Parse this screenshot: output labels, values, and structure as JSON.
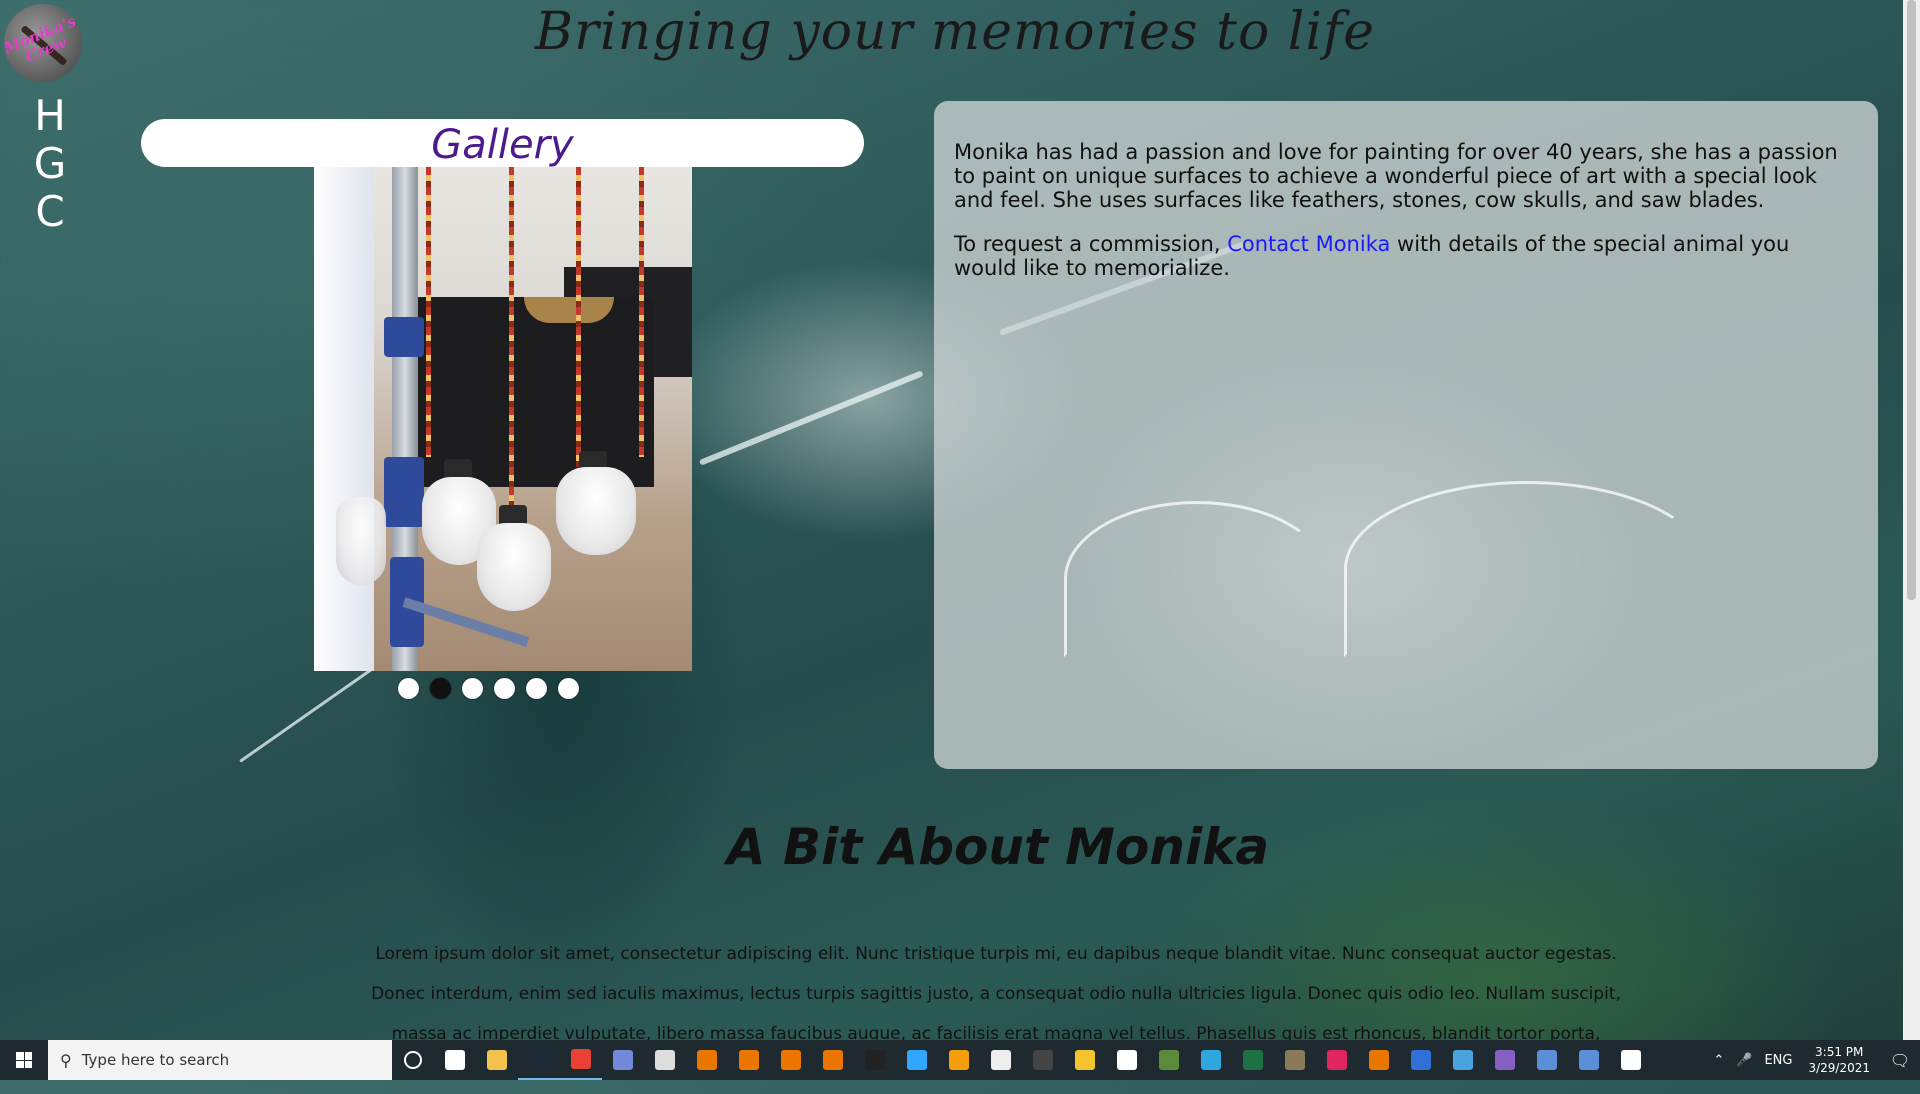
{
  "header": {
    "title": "Bringing your memories to life",
    "logo_text": "Monika's Crew"
  },
  "nav": {
    "items": [
      {
        "label": "H"
      },
      {
        "label": "G"
      },
      {
        "label": "C"
      }
    ]
  },
  "gallery": {
    "title": "Gallery",
    "slide_count": 6,
    "active_slide": 2
  },
  "info": {
    "paragraph1": "Monika has had a passion and love for painting for over 40 years, she has a passion to paint on unique surfaces to achieve a wonderful piece of art with a special look and feel. She uses surfaces like feathers, stones, cow skulls, and saw blades.",
    "paragraph2_before": "To request a commission, ",
    "contact_link": "Contact Monika",
    "paragraph2_after": " with details of the special animal you would like to memorialize."
  },
  "about": {
    "title": "A Bit About Monika",
    "body": "Lorem ipsum dolor sit amet, consectetur adipiscing elit. Nunc tristique turpis mi, eu dapibus neque blandit vitae. Nunc consequat auctor egestas. Donec interdum, enim sed iaculis maximus, lectus turpis sagittis justo, a consequat odio nulla ultricies ligula. Donec quis odio leo. Nullam suscipit, massa ac imperdiet vulputate, libero massa faucibus augue, ac facilisis erat magna vel tellus. Phasellus quis est rhoncus, blandit tortor porta, maximus massa. Nam"
  },
  "taskbar": {
    "search_placeholder": "Type here to search",
    "language": "ENG",
    "time": "3:51 PM",
    "date": "3/29/2021",
    "apps": [
      {
        "icon": "cortana-icon",
        "color": "#ffffff"
      },
      {
        "icon": "task-view-icon",
        "color": "#ffffff"
      },
      {
        "icon": "file-explorer-icon",
        "color": "#f2c14e"
      },
      {
        "icon": "steam-icon",
        "color": "#1b2838"
      },
      {
        "icon": "chrome-icon",
        "color": "#e94235"
      },
      {
        "icon": "discord-icon",
        "color": "#7289da"
      },
      {
        "icon": "inkscape-icon",
        "color": "#dddddd"
      },
      {
        "icon": "blender-icon",
        "color": "#ea7600"
      },
      {
        "icon": "blender-icon",
        "color": "#ea7600"
      },
      {
        "icon": "blender-icon",
        "color": "#ea7600"
      },
      {
        "icon": "blender-icon",
        "color": "#ea7600"
      },
      {
        "icon": "terminal-icon",
        "color": "#222222"
      },
      {
        "icon": "photoshop-icon",
        "color": "#31a8ff"
      },
      {
        "icon": "sublime-icon",
        "color": "#f59e0b"
      },
      {
        "icon": "unity-icon",
        "color": "#eeeeee"
      },
      {
        "icon": "obs-icon",
        "color": "#444444"
      },
      {
        "icon": "nuke-icon",
        "color": "#f4c430"
      },
      {
        "icon": "document-icon",
        "color": "#ffffff"
      },
      {
        "icon": "minecraft-icon",
        "color": "#5a8a3a"
      },
      {
        "icon": "edge-icon",
        "color": "#2fa6de"
      },
      {
        "icon": "excel-icon",
        "color": "#1e7145"
      },
      {
        "icon": "gimp-icon",
        "color": "#8a7a5a"
      },
      {
        "icon": "adobe-icon",
        "color": "#e0245e"
      },
      {
        "icon": "blender-icon",
        "color": "#ea7600"
      },
      {
        "icon": "app-blue-icon",
        "color": "#2f6fd6"
      },
      {
        "icon": "store-icon",
        "color": "#4aa3df"
      },
      {
        "icon": "visual-studio-icon",
        "color": "#865fc5"
      },
      {
        "icon": "mpc-icon",
        "color": "#5a8fd8"
      },
      {
        "icon": "app-star-icon",
        "color": "#5a8fd8"
      },
      {
        "icon": "vpn-icon",
        "color": "#ffffff"
      }
    ]
  }
}
